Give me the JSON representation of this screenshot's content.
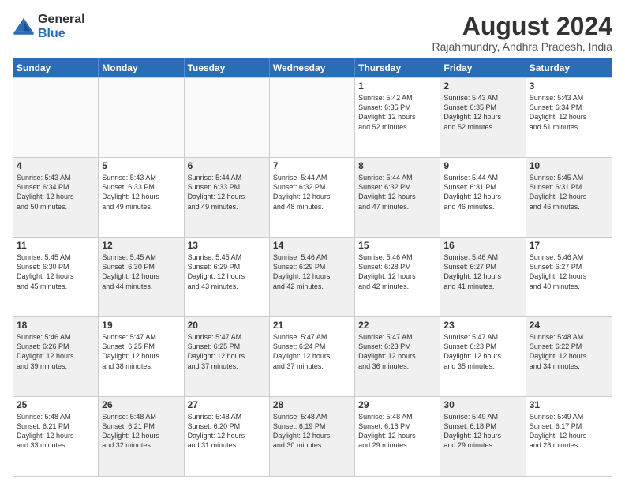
{
  "logo": {
    "line1": "General",
    "line2": "Blue"
  },
  "title": {
    "month_year": "August 2024",
    "location": "Rajahmundry, Andhra Pradesh, India"
  },
  "weekdays": [
    "Sunday",
    "Monday",
    "Tuesday",
    "Wednesday",
    "Thursday",
    "Friday",
    "Saturday"
  ],
  "rows": [
    [
      {
        "day": "",
        "info": "",
        "shaded": false,
        "empty": true
      },
      {
        "day": "",
        "info": "",
        "shaded": false,
        "empty": true
      },
      {
        "day": "",
        "info": "",
        "shaded": false,
        "empty": true
      },
      {
        "day": "",
        "info": "",
        "shaded": false,
        "empty": true
      },
      {
        "day": "1",
        "info": "Sunrise: 5:42 AM\nSunset: 6:35 PM\nDaylight: 12 hours\nand 52 minutes.",
        "shaded": false,
        "empty": false
      },
      {
        "day": "2",
        "info": "Sunrise: 5:43 AM\nSunset: 6:35 PM\nDaylight: 12 hours\nand 52 minutes.",
        "shaded": true,
        "empty": false
      },
      {
        "day": "3",
        "info": "Sunrise: 5:43 AM\nSunset: 6:34 PM\nDaylight: 12 hours\nand 51 minutes.",
        "shaded": false,
        "empty": false
      }
    ],
    [
      {
        "day": "4",
        "info": "Sunrise: 5:43 AM\nSunset: 6:34 PM\nDaylight: 12 hours\nand 50 minutes.",
        "shaded": true,
        "empty": false
      },
      {
        "day": "5",
        "info": "Sunrise: 5:43 AM\nSunset: 6:33 PM\nDaylight: 12 hours\nand 49 minutes.",
        "shaded": false,
        "empty": false
      },
      {
        "day": "6",
        "info": "Sunrise: 5:44 AM\nSunset: 6:33 PM\nDaylight: 12 hours\nand 49 minutes.",
        "shaded": true,
        "empty": false
      },
      {
        "day": "7",
        "info": "Sunrise: 5:44 AM\nSunset: 6:32 PM\nDaylight: 12 hours\nand 48 minutes.",
        "shaded": false,
        "empty": false
      },
      {
        "day": "8",
        "info": "Sunrise: 5:44 AM\nSunset: 6:32 PM\nDaylight: 12 hours\nand 47 minutes.",
        "shaded": true,
        "empty": false
      },
      {
        "day": "9",
        "info": "Sunrise: 5:44 AM\nSunset: 6:31 PM\nDaylight: 12 hours\nand 46 minutes.",
        "shaded": false,
        "empty": false
      },
      {
        "day": "10",
        "info": "Sunrise: 5:45 AM\nSunset: 6:31 PM\nDaylight: 12 hours\nand 46 minutes.",
        "shaded": true,
        "empty": false
      }
    ],
    [
      {
        "day": "11",
        "info": "Sunrise: 5:45 AM\nSunset: 6:30 PM\nDaylight: 12 hours\nand 45 minutes.",
        "shaded": false,
        "empty": false
      },
      {
        "day": "12",
        "info": "Sunrise: 5:45 AM\nSunset: 6:30 PM\nDaylight: 12 hours\nand 44 minutes.",
        "shaded": true,
        "empty": false
      },
      {
        "day": "13",
        "info": "Sunrise: 5:45 AM\nSunset: 6:29 PM\nDaylight: 12 hours\nand 43 minutes.",
        "shaded": false,
        "empty": false
      },
      {
        "day": "14",
        "info": "Sunrise: 5:46 AM\nSunset: 6:29 PM\nDaylight: 12 hours\nand 42 minutes.",
        "shaded": true,
        "empty": false
      },
      {
        "day": "15",
        "info": "Sunrise: 5:46 AM\nSunset: 6:28 PM\nDaylight: 12 hours\nand 42 minutes.",
        "shaded": false,
        "empty": false
      },
      {
        "day": "16",
        "info": "Sunrise: 5:46 AM\nSunset: 6:27 PM\nDaylight: 12 hours\nand 41 minutes.",
        "shaded": true,
        "empty": false
      },
      {
        "day": "17",
        "info": "Sunrise: 5:46 AM\nSunset: 6:27 PM\nDaylight: 12 hours\nand 40 minutes.",
        "shaded": false,
        "empty": false
      }
    ],
    [
      {
        "day": "18",
        "info": "Sunrise: 5:46 AM\nSunset: 6:26 PM\nDaylight: 12 hours\nand 39 minutes.",
        "shaded": true,
        "empty": false
      },
      {
        "day": "19",
        "info": "Sunrise: 5:47 AM\nSunset: 6:25 PM\nDaylight: 12 hours\nand 38 minutes.",
        "shaded": false,
        "empty": false
      },
      {
        "day": "20",
        "info": "Sunrise: 5:47 AM\nSunset: 6:25 PM\nDaylight: 12 hours\nand 37 minutes.",
        "shaded": true,
        "empty": false
      },
      {
        "day": "21",
        "info": "Sunrise: 5:47 AM\nSunset: 6:24 PM\nDaylight: 12 hours\nand 37 minutes.",
        "shaded": false,
        "empty": false
      },
      {
        "day": "22",
        "info": "Sunrise: 5:47 AM\nSunset: 6:23 PM\nDaylight: 12 hours\nand 36 minutes.",
        "shaded": true,
        "empty": false
      },
      {
        "day": "23",
        "info": "Sunrise: 5:47 AM\nSunset: 6:23 PM\nDaylight: 12 hours\nand 35 minutes.",
        "shaded": false,
        "empty": false
      },
      {
        "day": "24",
        "info": "Sunrise: 5:48 AM\nSunset: 6:22 PM\nDaylight: 12 hours\nand 34 minutes.",
        "shaded": true,
        "empty": false
      }
    ],
    [
      {
        "day": "25",
        "info": "Sunrise: 5:48 AM\nSunset: 6:21 PM\nDaylight: 12 hours\nand 33 minutes.",
        "shaded": false,
        "empty": false
      },
      {
        "day": "26",
        "info": "Sunrise: 5:48 AM\nSunset: 6:21 PM\nDaylight: 12 hours\nand 32 minutes.",
        "shaded": true,
        "empty": false
      },
      {
        "day": "27",
        "info": "Sunrise: 5:48 AM\nSunset: 6:20 PM\nDaylight: 12 hours\nand 31 minutes.",
        "shaded": false,
        "empty": false
      },
      {
        "day": "28",
        "info": "Sunrise: 5:48 AM\nSunset: 6:19 PM\nDaylight: 12 hours\nand 30 minutes.",
        "shaded": true,
        "empty": false
      },
      {
        "day": "29",
        "info": "Sunrise: 5:48 AM\nSunset: 6:18 PM\nDaylight: 12 hours\nand 29 minutes.",
        "shaded": false,
        "empty": false
      },
      {
        "day": "30",
        "info": "Sunrise: 5:49 AM\nSunset: 6:18 PM\nDaylight: 12 hours\nand 29 minutes.",
        "shaded": true,
        "empty": false
      },
      {
        "day": "31",
        "info": "Sunrise: 5:49 AM\nSunset: 6:17 PM\nDaylight: 12 hours\nand 28 minutes.",
        "shaded": false,
        "empty": false
      }
    ]
  ]
}
